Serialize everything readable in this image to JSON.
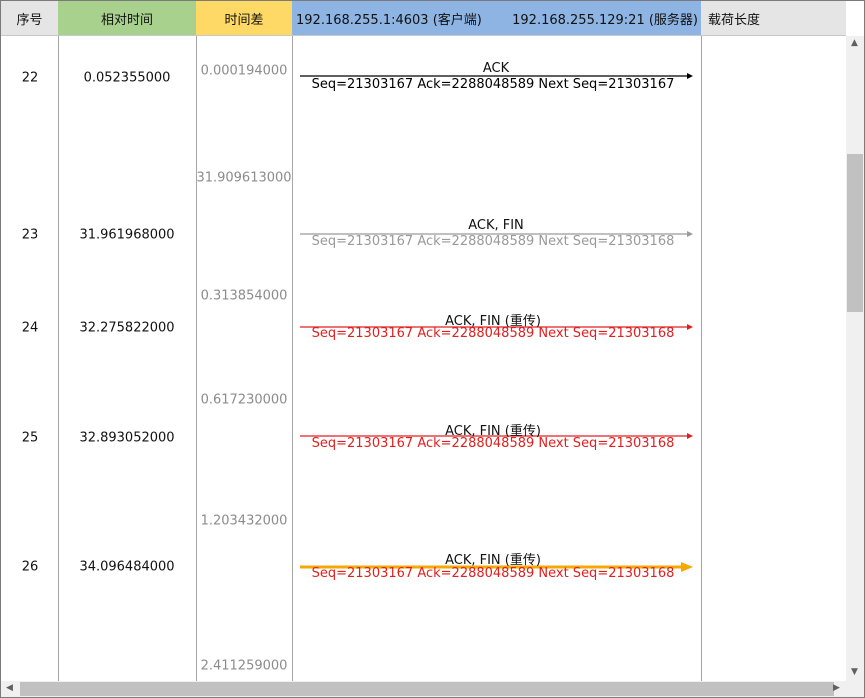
{
  "header": {
    "no": "序号",
    "rel_time": "相对时间",
    "time_diff": "时间差",
    "client": "192.168.255.1:4603 (客户端)",
    "server": "192.168.255.129:21 (服务器)",
    "payload": "载荷长度"
  },
  "diffs": {
    "d0": "0.000194000",
    "d1": "31.909613000",
    "d2": "0.313854000",
    "d3": "0.617230000",
    "d4": "1.203432000",
    "d5": "2.411259000"
  },
  "rows": [
    {
      "no": "22",
      "time": "0.052355000",
      "label": "ACK",
      "detail": "Seq=21303167  Ack=2288048589  Next Seq=21303167",
      "color": "#000000",
      "label_color": "#000000",
      "detail_color": "#000000"
    },
    {
      "no": "23",
      "time": "31.961968000",
      "label": "ACK, FIN",
      "detail": "Seq=21303167  Ack=2288048589  Next Seq=21303168",
      "color": "#9a9a9a",
      "label_color": "#000000",
      "detail_color": "#9a9a9a"
    },
    {
      "no": "24",
      "time": "32.275822000",
      "label": "ACK, FIN  (重传)",
      "detail": "Seq=21303167  Ack=2288048589  Next Seq=21303168",
      "color": "#e02020",
      "label_color": "#000000",
      "detail_color": "#e02020"
    },
    {
      "no": "25",
      "time": "32.893052000",
      "label": "ACK, FIN  (重传)",
      "detail": "Seq=21303167  Ack=2288048589  Next Seq=21303168",
      "color": "#e02020",
      "label_color": "#000000",
      "detail_color": "#e02020"
    },
    {
      "no": "26",
      "time": "34.096484000",
      "label": "ACK, FIN  (重传)",
      "detail": "Seq=21303167  Ack=2288048589  Next Seq=21303168",
      "color": "#f5a800",
      "label_color": "#000000",
      "detail_color": "#e02020"
    }
  ]
}
